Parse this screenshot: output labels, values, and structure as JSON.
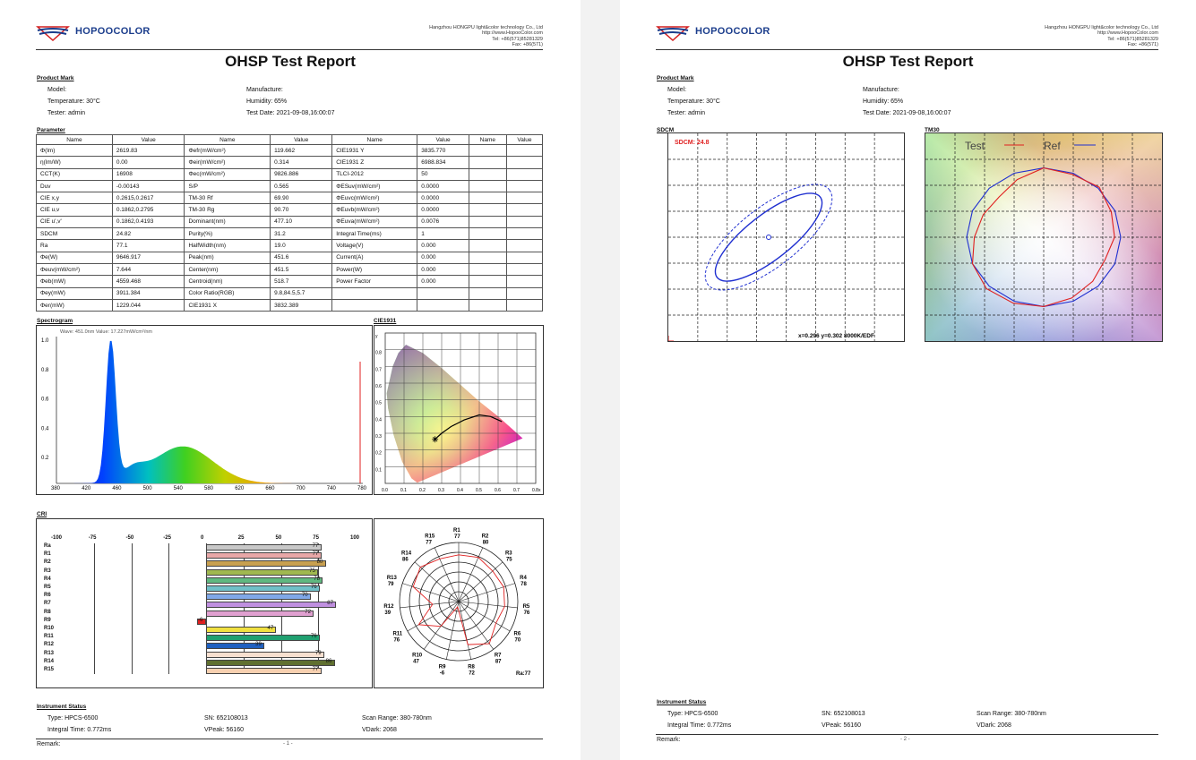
{
  "brand": {
    "logo_text": "HOPOOCOLOR"
  },
  "company": {
    "name": "Hangzhou HONGPU light&color technology Co., Ltd",
    "web": "http://www.HopooColor.com",
    "tel": "Tel: +86(571)85281329",
    "fax": "Fax: +86(571)"
  },
  "report_title": "OHSP Test Report",
  "product_mark": {
    "heading": "Product Mark",
    "model": "Model:",
    "manufacture": "Manufacture:",
    "temperature": "Temperature: 30°C",
    "humidity": "Humidity: 65%",
    "tester": "Tester: admin",
    "test_date": "Test Date: 2021-09-08,16:00:07"
  },
  "parameter": {
    "heading": "Parameter",
    "headers": [
      "Name",
      "Value",
      "Name",
      "Value",
      "Name",
      "Value",
      "Name",
      "Value"
    ],
    "rows": [
      [
        "Φ(lm)",
        "2619.83",
        "Φefr(mW/cm²)",
        "119.662",
        "CIE1931 Y",
        "3835.770",
        "",
        ""
      ],
      [
        "η(lm/W)",
        "0.00",
        "Φeir(mW/cm²)",
        "0.314",
        "CIE1931 Z",
        "6988.834",
        "",
        ""
      ],
      [
        "CCT(K)",
        "16908",
        "Φec(mW/cm²)",
        "9826.886",
        "TLCI-2012",
        "50",
        "",
        ""
      ],
      [
        "Duv",
        "-0.00143",
        "S/P",
        "0.565",
        "ΦESuv(mW/cm²)",
        "0.0000",
        "",
        ""
      ],
      [
        "CIE x,y",
        "0.2615,0.2617",
        "TM-30 Rf",
        "69.90",
        "ΦEuvc(mW/cm²)",
        "0.0000",
        "",
        ""
      ],
      [
        "CIE u,v",
        "0.1862,0.2795",
        "TM-30 Rg",
        "90.70",
        "ΦEuvb(mW/cm²)",
        "0.0000",
        "",
        ""
      ],
      [
        "CIE u',v'",
        "0.1862,0.4193",
        "Dominant(nm)",
        "477.10",
        "ΦEuva(mW/cm²)",
        "0.0076",
        "",
        ""
      ],
      [
        "SDCM",
        "24.82",
        "Purity(%)",
        "31.2",
        "Integral Time(ms)",
        "1",
        "",
        ""
      ],
      [
        "Ra",
        "77.1",
        "HalfWidth(nm)",
        "19.0",
        "Voltage(V)",
        "0.000",
        "",
        ""
      ],
      [
        "Φe(W)",
        "9646.917",
        "Peak(nm)",
        "451.6",
        "Current(A)",
        "0.000",
        "",
        ""
      ],
      [
        "Φeuv(mW/cm²)",
        "7.644",
        "Center(nm)",
        "451.5",
        "Power(W)",
        "0.000",
        "",
        ""
      ],
      [
        "Φeb(mW)",
        "4559.468",
        "Centroid(nm)",
        "518.7",
        "Power Factor",
        "0.000",
        "",
        ""
      ],
      [
        "Φey(mW)",
        "3911.384",
        "Color Ratio(RGB)",
        "9.8,84.5,5.7",
        "",
        "",
        "",
        ""
      ],
      [
        "Φer(mW)",
        "1229.044",
        "CIE1931 X",
        "3832.389",
        "",
        "",
        "",
        ""
      ]
    ]
  },
  "spectrogram": {
    "heading": "Spectrogram",
    "readout": "Wave: 451.0nm Value: 17.227mW/cm²/nm",
    "x_ticks": [
      "380",
      "420",
      "460",
      "500",
      "540",
      "580",
      "620",
      "660",
      "700",
      "740",
      "780"
    ],
    "y_ticks": [
      "1.0",
      "0.8",
      "0.6",
      "0.4",
      "0.2"
    ]
  },
  "cie": {
    "heading": "CIE1931",
    "x_ticks": [
      "0.0",
      "0.1",
      "0.2",
      "0.3",
      "0.4",
      "0.5",
      "0.6",
      "0.7",
      "0.8x"
    ],
    "y_ticks": [
      "y",
      "0.8",
      "0.7",
      "0.6",
      "0.5",
      "0.4",
      "0.3",
      "0.2",
      "0.1"
    ]
  },
  "cri": {
    "heading": "CRI",
    "axis_ticks": [
      "-100",
      "-75",
      "-50",
      "-25",
      "0",
      "25",
      "50",
      "75",
      "100"
    ],
    "items": [
      {
        "label": "Ra",
        "value": 77,
        "color": "#c8c8c8"
      },
      {
        "label": "R1",
        "value": 77,
        "color": "#e8a8a8"
      },
      {
        "label": "R2",
        "value": 80,
        "color": "#c8a050"
      },
      {
        "label": "R3",
        "value": 75,
        "color": "#a0b850"
      },
      {
        "label": "R4",
        "value": 78,
        "color": "#60b880"
      },
      {
        "label": "R5",
        "value": 76,
        "color": "#70c0c8"
      },
      {
        "label": "R6",
        "value": 70,
        "color": "#80a8e8"
      },
      {
        "label": "R7",
        "value": 87,
        "color": "#c090e0"
      },
      {
        "label": "R8",
        "value": 72,
        "color": "#e0a0d0"
      },
      {
        "label": "R9",
        "value": -6,
        "color": "#e02020"
      },
      {
        "label": "R10",
        "value": 47,
        "color": "#f0e040"
      },
      {
        "label": "R11",
        "value": 76,
        "color": "#20a070"
      },
      {
        "label": "R12",
        "value": 39,
        "color": "#2060c0"
      },
      {
        "label": "R13",
        "value": 79,
        "color": "#f8e0d0"
      },
      {
        "label": "R14",
        "value": 86,
        "color": "#607030"
      },
      {
        "label": "R15",
        "value": 77,
        "color": "#f8d0b0"
      }
    ],
    "radar": {
      "labels": [
        {
          "name": "R1",
          "val": "77"
        },
        {
          "name": "R2",
          "val": "80"
        },
        {
          "name": "R3",
          "val": "75"
        },
        {
          "name": "R4",
          "val": "78"
        },
        {
          "name": "R5",
          "val": "76"
        },
        {
          "name": "R6",
          "val": "70"
        },
        {
          "name": "R7",
          "val": "87"
        },
        {
          "name": "R8",
          "val": "72"
        },
        {
          "name": "R9",
          "val": "-6"
        },
        {
          "name": "R10",
          "val": "47"
        },
        {
          "name": "R11",
          "val": "76"
        },
        {
          "name": "R12",
          "val": "39"
        },
        {
          "name": "R13",
          "val": "79"
        },
        {
          "name": "R14",
          "val": "86"
        },
        {
          "name": "R15",
          "val": "77"
        }
      ],
      "ra_label": "Ra:77"
    }
  },
  "instrument": {
    "heading": "Instrument Status",
    "type": "Type: HPCS-6500",
    "sn": "SN: 652108013",
    "scan_range": "Scan Range: 380-780nm",
    "integral_time": "Integral Time: 0.772ms",
    "vpeak": "VPeak: 56160",
    "vdark": "VDark: 2068",
    "remark": "Remark:"
  },
  "page1_number": "- 1 -",
  "page2_number": "- 2 -",
  "sdcm": {
    "heading": "SDCM",
    "value_label": "SDCM: 24.8",
    "readout": "x=0.296 y=0.302 8000K/EDF"
  },
  "tm30": {
    "heading": "TM30",
    "legend_test": "Test",
    "legend_ref": "Ref"
  },
  "colors": {
    "test_line": "#e02020",
    "ref_line": "#2030d0",
    "brand_blue": "#1b3d8c",
    "brand_red": "#d42020"
  }
}
